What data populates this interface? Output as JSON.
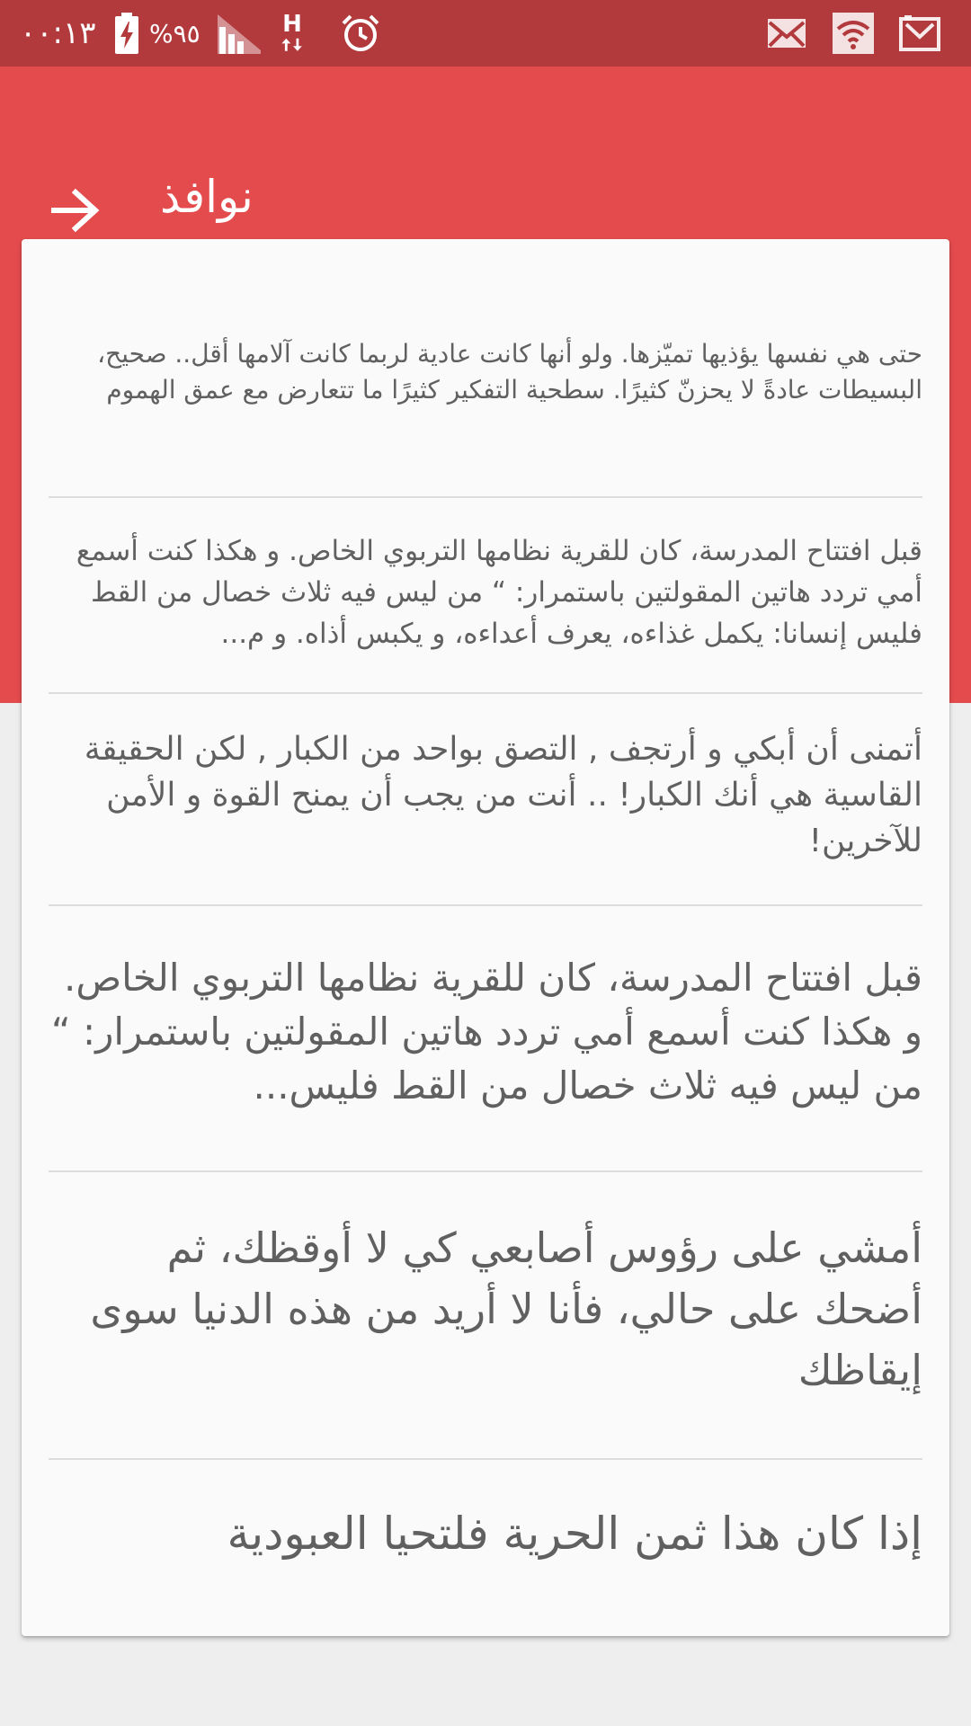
{
  "status_bar": {
    "time": "٠٠:١٣",
    "battery_percent": "%٩٥",
    "network_type": "H",
    "icons": [
      "battery-charging-icon",
      "signal-icon",
      "h-data-icon",
      "alarm-icon",
      "mail-icon",
      "wifi-icon",
      "gmail-icon"
    ]
  },
  "app_bar": {
    "title": "نوافذ",
    "back_icon": "arrow-right-icon"
  },
  "colors": {
    "status_bar": "#b23a3c",
    "primary": "#e44b4d",
    "card": "#fafafa",
    "text": "#606060",
    "background": "#eeeeee"
  },
  "quotes": [
    "حتى هي نفسها يؤذيها تميّزها. ولو أنها كانت عادية لربما كانت آلامها أقل.. صحيح، البسيطات عادةً لا يحزنّ كثيرًا. سطحية التفكير كثيرًا ما تتعارض مع عمق الهموم",
    "قبل افتتاح المدرسة، كان للقرية نظامها التربوي الخاص. و هكذا كنت أسمع أمي تردد هاتين المقولتين باستمرار: “ من ليس فيه ثلاث خصال من القط فليس إنسانا: يكمل غذاءه، يعرف أعداءه، و يكبس أذاه. و م...",
    "أتمنى أن أبكي و أرتجف , التصق بواحد من الكبار , لكن الحقيقة القاسية هي أنك الكبار! .. أنت من يجب أن يمنح القوة و الأمن للآخرين!",
    "قبل افتتاح المدرسة، كان للقرية نظامها التربوي الخاص. و هكذا كنت أسمع أمي تردد هاتين المقولتين باستمرار: “ من ليس فيه ثلاث خصال من القط فليس...",
    "أمشي على رؤوس أصابعي كي لا أوقظك، ثم أضحك على حالي، فأنا لا أريد من هذه الدنيا سوى إيقاظك",
    "إذا كان هذا ثمن الحرية فلتحيا العبودية"
  ]
}
